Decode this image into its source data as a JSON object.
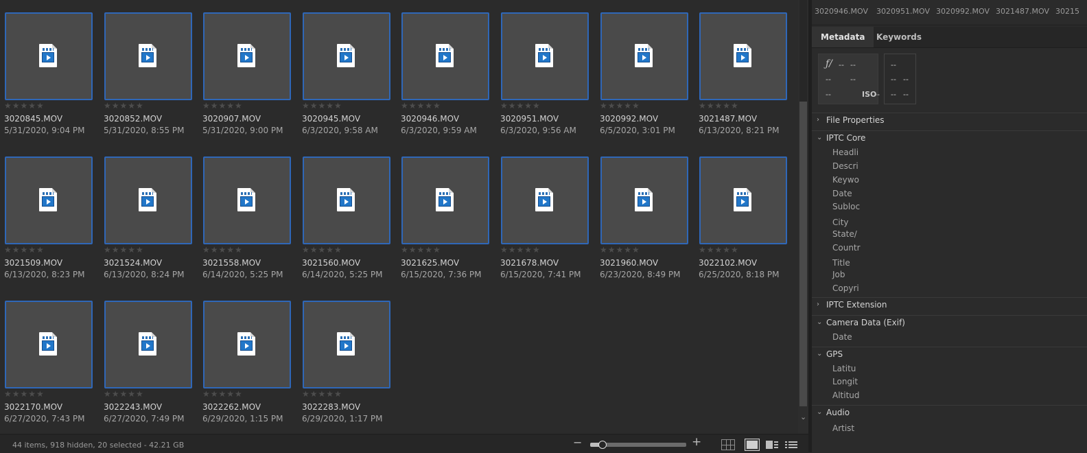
{
  "grid": {
    "files": [
      {
        "name": "3020845.MOV",
        "date": "5/31/2020, 9:04 PM",
        "rating": "★★★★★"
      },
      {
        "name": "3020852.MOV",
        "date": "5/31/2020, 8:55 PM",
        "rating": "★★★★★"
      },
      {
        "name": "3020907.MOV",
        "date": "5/31/2020, 9:00 PM",
        "rating": "★★★★★"
      },
      {
        "name": "3020945.MOV",
        "date": "6/3/2020, 9:58 AM",
        "rating": "★★★★★"
      },
      {
        "name": "3020946.MOV",
        "date": "6/3/2020, 9:59 AM",
        "rating": "★★★★★"
      },
      {
        "name": "3020951.MOV",
        "date": "6/3/2020, 9:56 AM",
        "rating": "★★★★★"
      },
      {
        "name": "3020992.MOV",
        "date": "6/5/2020, 3:01 PM",
        "rating": "★★★★★"
      },
      {
        "name": "3021487.MOV",
        "date": "6/13/2020, 8:21 PM",
        "rating": "★★★★★"
      },
      {
        "name": "3021509.MOV",
        "date": "6/13/2020, 8:23 PM",
        "rating": "★★★★★"
      },
      {
        "name": "3021524.MOV",
        "date": "6/13/2020, 8:24 PM",
        "rating": "★★★★★"
      },
      {
        "name": "3021558.MOV",
        "date": "6/14/2020, 5:25 PM",
        "rating": "★★★★★"
      },
      {
        "name": "3021560.MOV",
        "date": "6/14/2020, 5:25 PM",
        "rating": "★★★★★"
      },
      {
        "name": "3021625.MOV",
        "date": "6/15/2020, 7:36 PM",
        "rating": "★★★★★"
      },
      {
        "name": "3021678.MOV",
        "date": "6/15/2020, 7:41 PM",
        "rating": "★★★★★"
      },
      {
        "name": "3021960.MOV",
        "date": "6/23/2020, 8:49 PM",
        "rating": "★★★★★"
      },
      {
        "name": "3022102.MOV",
        "date": "6/25/2020, 8:18 PM",
        "rating": "★★★★★"
      },
      {
        "name": "3022170.MOV",
        "date": "6/27/2020, 7:43 PM",
        "rating": "★★★★★"
      },
      {
        "name": "3022243.MOV",
        "date": "6/27/2020, 7:49 PM",
        "rating": "★★★★★"
      },
      {
        "name": "3022262.MOV",
        "date": "6/29/2020, 1:15 PM",
        "rating": "★★★★★"
      },
      {
        "name": "3022283.MOV",
        "date": "6/29/2020, 1:17 PM",
        "rating": "★★★★★"
      }
    ],
    "file_icon": "video-file-icon",
    "selection_color": "#2f67b8"
  },
  "status": {
    "text": "44 items, 918 hidden, 20 selected - 42.21 GB",
    "zoom_minus": "−",
    "zoom_plus": "+",
    "zoom_level": 0.12
  },
  "filmstrip": {
    "items": [
      "3020946.MOV",
      "3020951.MOV",
      "3020992.MOV",
      "3021487.MOV",
      "30215"
    ]
  },
  "tabs": {
    "metadata": "Metadata",
    "keywords": "Keywords"
  },
  "exif": {
    "fstop_symbol": "ƒ/",
    "fstop_value": "--",
    "shutter": "--",
    "r2c1": "--",
    "r2c2": "--",
    "r3c1": "--",
    "iso_label": "ISO",
    "iso_value": "--",
    "b2_r1": "--",
    "b2_r2c1": "--",
    "b2_r2c2": "--",
    "b2_r3c1": "--",
    "b2_r3c2": "--"
  },
  "sections": {
    "file_properties": {
      "chevron": "›",
      "title": "File Properties"
    },
    "iptc_core": {
      "chevron": "⌄",
      "title": "IPTC Core",
      "fields": [
        "Headli",
        "Descri",
        "Keywo",
        "Date",
        "Subloc",
        "City",
        "State/",
        "Countr",
        "Title",
        "Job",
        "Copyri"
      ]
    },
    "iptc_extension": {
      "chevron": "›",
      "title": "IPTC Extension"
    },
    "camera_data": {
      "chevron": "⌄",
      "title": "Camera Data (Exif)",
      "fields": [
        "Date"
      ]
    },
    "gps": {
      "chevron": "⌄",
      "title": "GPS",
      "fields": [
        "Latitu",
        "Longit",
        "Altitud"
      ]
    },
    "audio": {
      "chevron": "⌄",
      "title": "Audio",
      "fields": [
        "Artist"
      ]
    }
  }
}
